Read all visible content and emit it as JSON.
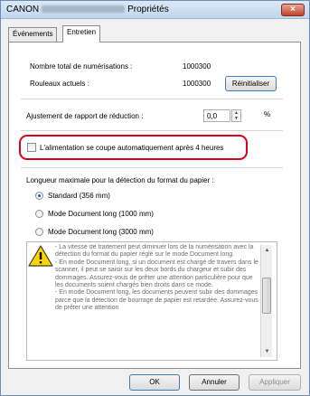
{
  "window": {
    "title_prefix": "CANON",
    "title_suffix": "Propriétés",
    "close_label": "×"
  },
  "tabs": [
    {
      "label": "Événements",
      "active": false
    },
    {
      "label": "Entretien",
      "active": true
    }
  ],
  "counters": {
    "total_scans_label": "Nombre total de numérisations :",
    "total_scans_value": "1000300",
    "rollers_label": "Rouleaux actuels :",
    "rollers_value": "1000300",
    "reset_button": "Réinitialiser"
  },
  "reduction": {
    "label": "Ajustement de rapport de réduction :",
    "value": "0,0",
    "unit": "%"
  },
  "power_off": {
    "label": "L'alimentation se coupe automatiquement après 4 heures",
    "checked": false
  },
  "paper_length": {
    "label": "Longueur maximale pour la détection du format du papier :",
    "options": [
      {
        "label": "Standard (356 mm)",
        "selected": true
      },
      {
        "label": "Mode Document long (1000 mm)",
        "selected": false
      },
      {
        "label": "Mode Document long (3000 mm)",
        "selected": false
      }
    ]
  },
  "notes": [
    "- La vitesse de traitement peut diminuer lors de la numérisation avec la détection du format du papier réglé sur le mode Document long.",
    "- En mode Document long, si un document est chargé de travers dans le scanner, il peut se saisir sur les deux bords du chargeur et subir des dommages. Assurez-vous de prêter une attention particulière pour que les documents soient chargés bien droits dans ce mode.",
    "- En mode Document long, les documents peuvent subir des dommages parce que la détection de bourrage de papier est retardée. Assurez-vous de prêter une attention"
  ],
  "footer": {
    "ok": "OK",
    "cancel": "Annuler",
    "apply": "Appliquer"
  },
  "colors": {
    "highlight": "#e0001b",
    "warning_icon": "#ffd400"
  }
}
